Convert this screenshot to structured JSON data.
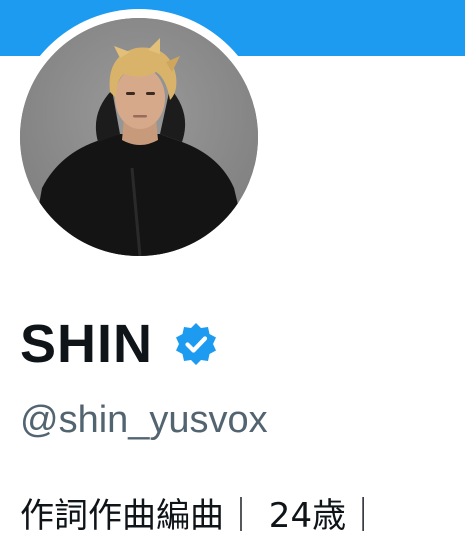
{
  "profile": {
    "display_name": "SHIN",
    "handle": "@shin_yusvox",
    "bio": "作詞作曲編曲｜ 24歳｜"
  },
  "icons": {
    "verified": "verified-badge-icon"
  },
  "colors": {
    "banner": "#1d9bf0",
    "verified": "#1d9bf0",
    "text_primary": "#0f1419",
    "text_secondary": "#536471"
  }
}
